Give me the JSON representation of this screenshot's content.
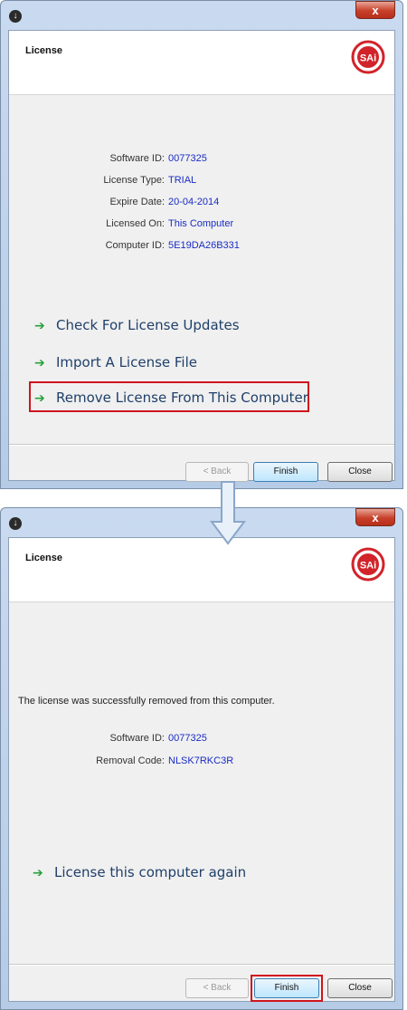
{
  "window1": {
    "close_symbol": "x",
    "header": {
      "title": "License",
      "logo_text": "SAi"
    },
    "info": [
      {
        "label": "Software ID:",
        "value": "0077325"
      },
      {
        "label": "License Type:",
        "value": "TRIAL"
      },
      {
        "label": "Expire Date:",
        "value": "20-04-2014"
      },
      {
        "label": "Licensed On:",
        "value": "This Computer"
      },
      {
        "label": "Computer ID:",
        "value": "5E19DA26B331"
      }
    ],
    "links": [
      "Check For License Updates",
      "Import A License File",
      "Remove License From This Computer"
    ],
    "buttons": {
      "back": "< Back",
      "finish": "Finish",
      "close": "Close"
    }
  },
  "window2": {
    "close_symbol": "x",
    "header": {
      "title": "License",
      "logo_text": "SAi"
    },
    "message": "The license was successfully removed from this computer.",
    "info": [
      {
        "label": "Software ID:",
        "value": "0077325"
      },
      {
        "label": "Removal Code:",
        "value": "NLSK7RKC3R"
      }
    ],
    "links": [
      "License this computer again"
    ],
    "buttons": {
      "back": "< Back",
      "finish": "Finish",
      "close": "Close"
    }
  },
  "colors": {
    "highlight": "#d0141c",
    "link_arrow": "#28a03c",
    "value_text": "#1a2cc4",
    "logo_red": "#d2232a"
  }
}
